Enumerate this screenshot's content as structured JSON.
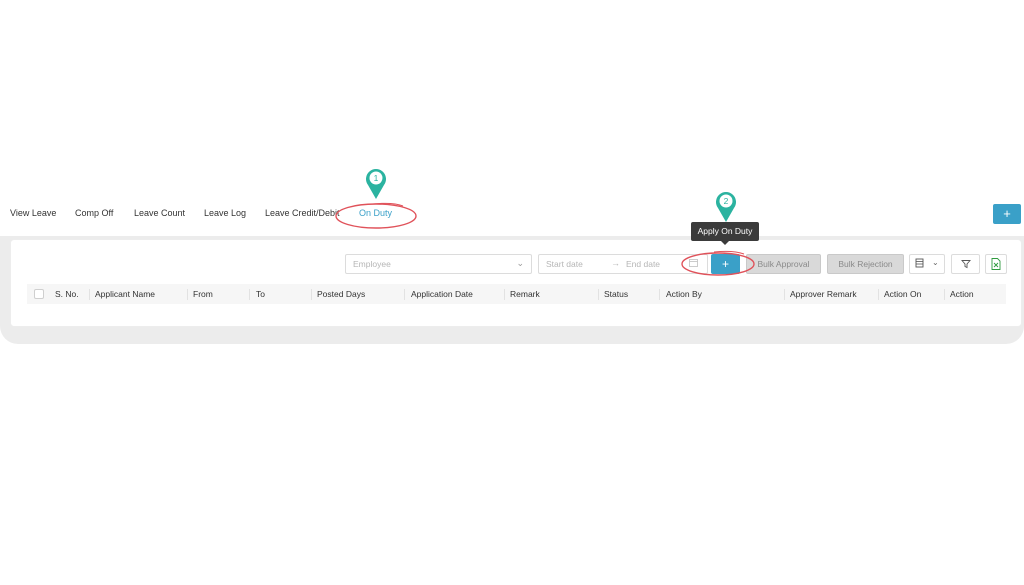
{
  "tabs": [
    {
      "label": "View Leave"
    },
    {
      "label": "Comp Off"
    },
    {
      "label": "Leave Count"
    },
    {
      "label": "Leave Log"
    },
    {
      "label": "Leave Credit/Debit"
    },
    {
      "label": "On Duty",
      "active": true
    }
  ],
  "header": {
    "add_button_label": "+"
  },
  "toolbar": {
    "employee_placeholder": "Employee",
    "start_date_placeholder": "Start date",
    "end_date_placeholder": "End date",
    "date_separator": "→",
    "add_label": "+",
    "bulk_approval_label": "Bulk Approval",
    "bulk_rejection_label": "Bulk Rejection",
    "columns_chevron": "⌄"
  },
  "tooltip": {
    "text": "Apply On Duty"
  },
  "markers": [
    {
      "number": "1"
    },
    {
      "number": "2"
    }
  ],
  "table": {
    "columns": [
      "S. No.",
      "Applicant Name",
      "From",
      "To",
      "Posted Days",
      "Application Date",
      "Remark",
      "Status",
      "Action By",
      "Approver Remark",
      "Action On",
      "Action"
    ]
  },
  "colors": {
    "accent": "#3aa0c8",
    "marker": "#2bb3a0",
    "highlight": "#e0525a"
  },
  "icons": [
    "chevron-down-icon",
    "arrow-right-icon",
    "calendar-icon",
    "columns-icon",
    "filter-icon",
    "excel-export-icon",
    "map-pin-icon"
  ]
}
